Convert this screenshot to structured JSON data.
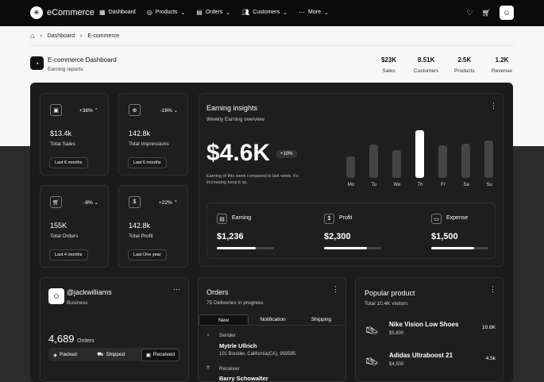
{
  "nav": {
    "brand": "eCommerce",
    "items": [
      {
        "label": "Dashboard",
        "icon": "dashboard-icon"
      },
      {
        "label": "Products",
        "icon": "box-icon"
      },
      {
        "label": "Orders",
        "icon": "document-icon"
      },
      {
        "label": "Customers",
        "icon": "users-icon"
      },
      {
        "label": "More",
        "icon": "dots-icon"
      }
    ]
  },
  "breadcrumb": {
    "items": [
      "Dashboard",
      "E-commerce"
    ]
  },
  "header": {
    "title": "E-commerce Dashboard",
    "subtitle": "Earning reports",
    "summary": [
      {
        "value": "$23K",
        "label": "Sales"
      },
      {
        "value": "8.51K",
        "label": "Customers"
      },
      {
        "value": "2.5K",
        "label": "Products"
      },
      {
        "value": "1.2K",
        "label": "Revenue"
      }
    ]
  },
  "stats": [
    {
      "value": "$13.4k",
      "label": "Total Sales",
      "delta": "+38%",
      "range": "Last 6 months",
      "icon": "image-icon"
    },
    {
      "value": "142.8k",
      "label": "Total Impressions",
      "delta": "-16%",
      "range": "Last 6 months",
      "icon": "globe-icon"
    },
    {
      "value": "155K",
      "label": "Total Orders",
      "delta": "-8%",
      "range": "Last 4 months",
      "icon": "cart-icon"
    },
    {
      "value": "142.8k",
      "label": "Total Profit",
      "delta": "+22%",
      "range": "Last One year",
      "icon": "dollar-icon"
    }
  ],
  "earning": {
    "title": "Earning insights",
    "subtitle": "Weekly Earning overview",
    "amount": "$4.6K",
    "badge": "+10%",
    "note": "Earning of this week compared to last week. it's increasing keep it up.",
    "metrics": [
      {
        "label": "Earning",
        "value": "$1,236",
        "progress": 0.68,
        "icon": "wallet-icon"
      },
      {
        "label": "Profit",
        "value": "$2,300",
        "progress": 0.75,
        "icon": "dollar-icon"
      },
      {
        "label": "Expense",
        "value": "$1,500",
        "progress": 0.75,
        "icon": "card-icon"
      }
    ]
  },
  "chart_data": {
    "type": "bar",
    "categories": [
      "Mo",
      "Tu",
      "We",
      "Th",
      "Fr",
      "Sa",
      "Su"
    ],
    "values": [
      27,
      42,
      35,
      60,
      41,
      43,
      47
    ],
    "highlight": "Th",
    "xlabel": "",
    "ylabel": ""
  },
  "profile": {
    "name": "@jackwilliams",
    "role": "Business",
    "count": "4,689",
    "count_label": "Orders",
    "segments": [
      "Packed",
      "Shipped",
      "Received"
    ],
    "active_segment": "Received"
  },
  "orders": {
    "title": "Orders",
    "subtitle": "75 Deliveries in progress",
    "tabs": [
      "New",
      "Notification",
      "Shipping"
    ],
    "sender": {
      "label": "Sender",
      "name": "Mytrle Ullrich",
      "address": "101 Boulder, California(CA), 959595"
    },
    "receiver": {
      "label": "Receiver",
      "name": "Barry Schowalter"
    }
  },
  "popular": {
    "title": "Popular product",
    "subtitle": "Total 10.4K visitors",
    "items": [
      {
        "name": "Nike Vision Low Shoes",
        "price": "$5,600",
        "sales": "10.6K"
      },
      {
        "name": "Adidas Ultraboost 21",
        "price": "$4,500",
        "sales": "4.5k"
      }
    ]
  }
}
